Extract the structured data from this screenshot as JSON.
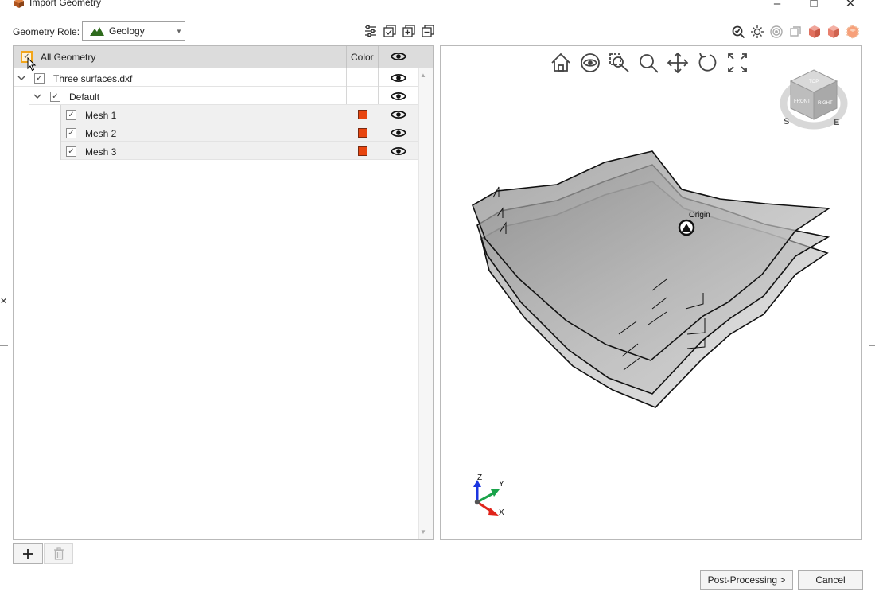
{
  "window": {
    "title": "Import Geometry"
  },
  "toolbar": {
    "geometry_role_label": "Geometry Role:",
    "geometry_role_value": "Geology"
  },
  "tree": {
    "header": {
      "all_label": "All Geometry",
      "color_label": "Color"
    },
    "file": {
      "label": "Three surfaces.dxf"
    },
    "group": {
      "label": "Default"
    },
    "meshes": [
      {
        "label": "Mesh 1",
        "color": "#e8450f"
      },
      {
        "label": "Mesh 2",
        "color": "#e8450f"
      },
      {
        "label": "Mesh 3",
        "color": "#e8450f"
      }
    ]
  },
  "viewport": {
    "origin_label": "Origin",
    "axes": {
      "z": "Z",
      "y": "Y",
      "x": "X"
    },
    "view_cube": {
      "face_top": "TOP",
      "face_front": "FRONT",
      "face_right": "RIGHT",
      "compass_s": "S",
      "compass_e": "E"
    }
  },
  "footer": {
    "post_processing_label": "Post-Processing >",
    "cancel_label": "Cancel"
  },
  "colors": {
    "accent": "#f2a51a",
    "mesh": "#e8450f"
  }
}
